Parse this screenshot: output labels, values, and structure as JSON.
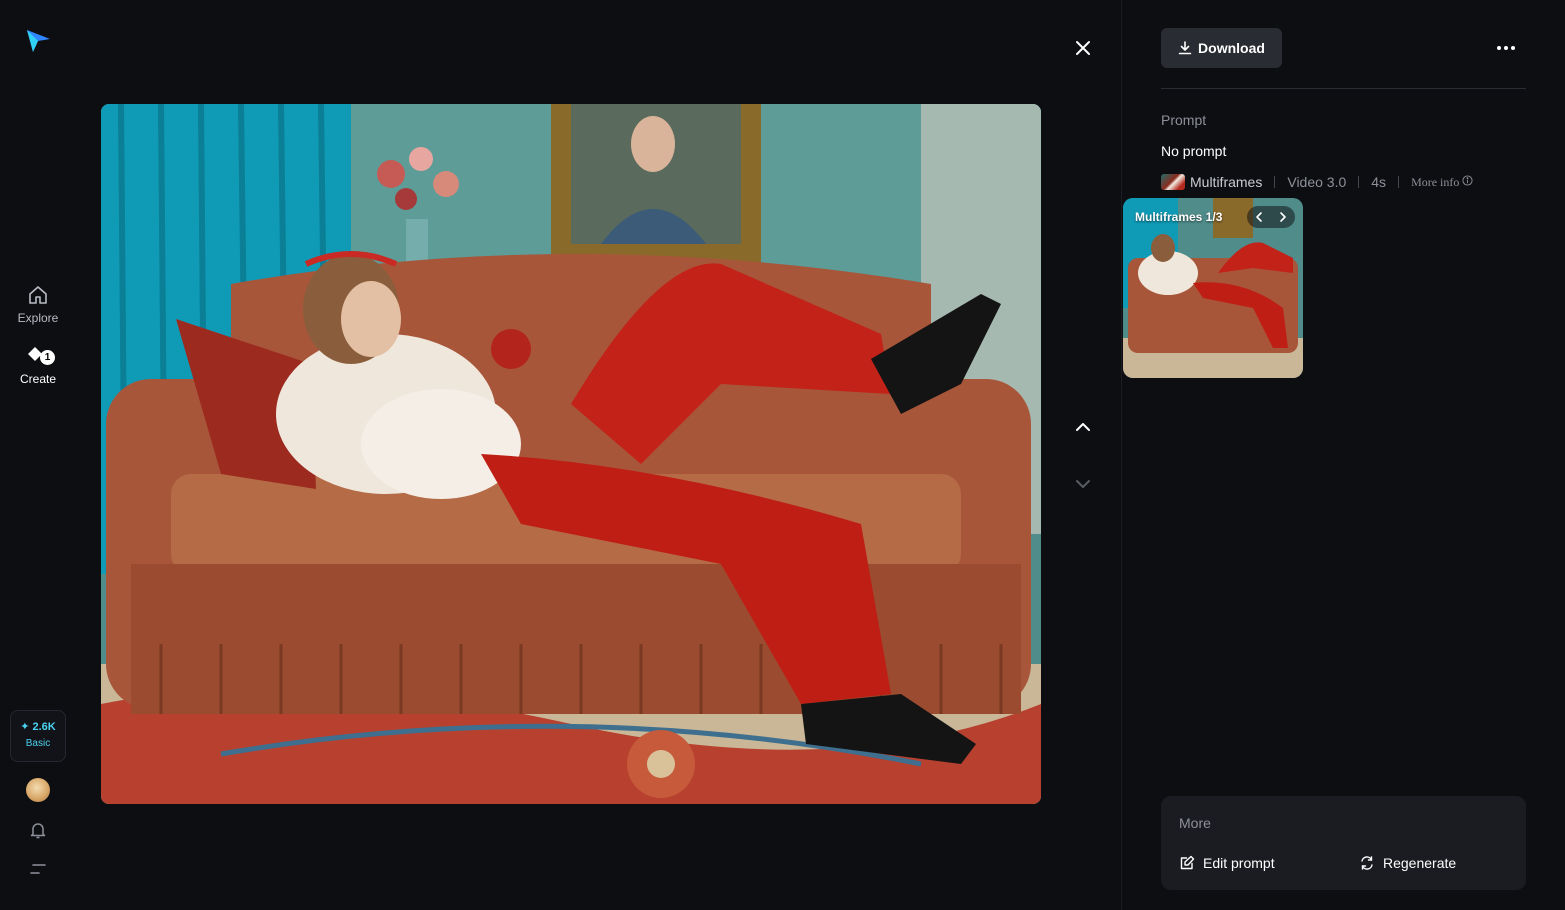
{
  "nav": {
    "explore_label": "Explore",
    "create_label": "Create",
    "create_badge": "1",
    "credits_amount": "✦ 2.6K",
    "plan": "Basic"
  },
  "icons": {
    "logo": "logo-icon",
    "explore": "home-icon",
    "create": "create-sparkle-icon",
    "bell": "bell-icon",
    "menu": "menu-icon",
    "close": "close-icon",
    "up": "chevron-up-icon",
    "down": "chevron-down-icon",
    "download": "download-icon",
    "more": "more-horizontal-icon",
    "info": "info-icon",
    "edit": "edit-icon",
    "regenerate": "regenerate-icon"
  },
  "colors": {
    "accent": "#49d3f0",
    "logo_primary": "#2f86ff",
    "logo_secondary": "#31d0f5",
    "background": "#0d0e12"
  },
  "panel": {
    "download_label": "Download",
    "prompt_label": "Prompt",
    "prompt_text": "No prompt",
    "model": "Multiframes",
    "version": "Video 3.0",
    "duration": "4s",
    "more_info": "More info",
    "frames_label": "Multiframes 1/3",
    "more_title": "More",
    "edit_prompt": "Edit prompt",
    "regenerate": "Regenerate"
  }
}
